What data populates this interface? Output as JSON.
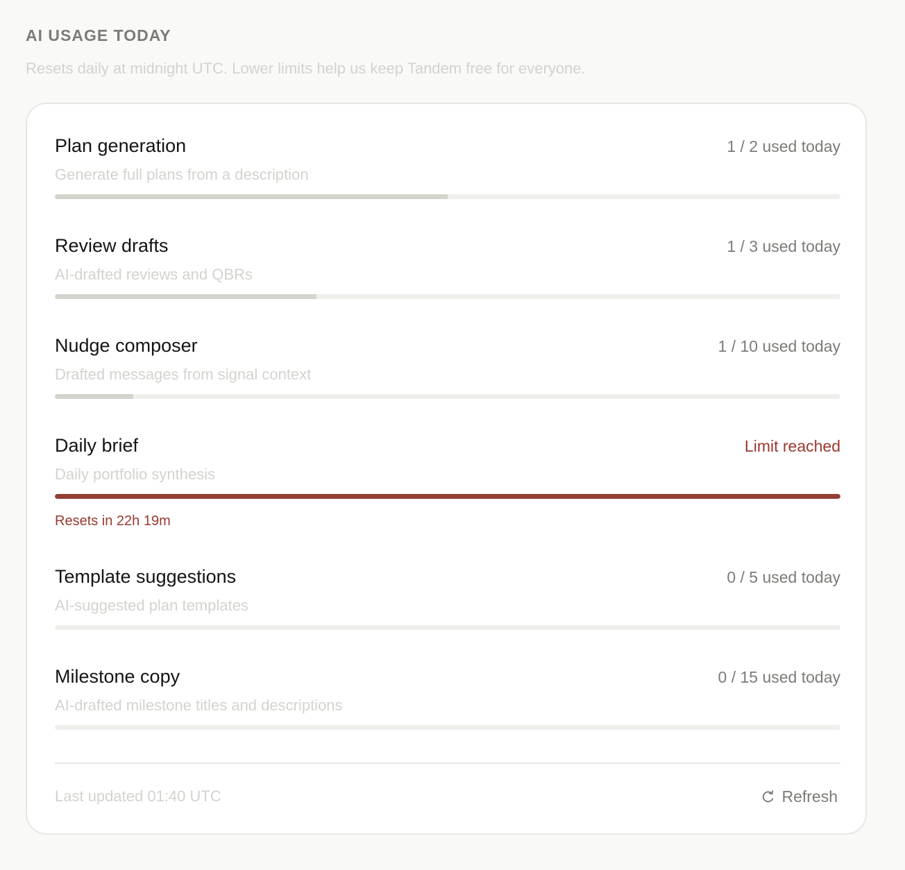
{
  "header": {
    "title": "AI USAGE TODAY",
    "subtitle": "Resets daily at midnight UTC. Lower limits help us keep Tandem free for everyone."
  },
  "usage_items": [
    {
      "name": "Plan generation",
      "description": "Generate full plans from a description",
      "used": 1,
      "limit": 2,
      "status_text": "1 / 2 used today",
      "fraction": 0.5
    },
    {
      "name": "Review drafts",
      "description": "AI-drafted reviews and QBRs",
      "used": 1,
      "limit": 3,
      "status_text": "1 / 3 used today",
      "fraction": 0.3333
    },
    {
      "name": "Nudge composer",
      "description": "Drafted messages from signal context",
      "used": 1,
      "limit": 10,
      "status_text": "1 / 10 used today",
      "fraction": 0.1
    },
    {
      "name": "Daily brief",
      "description": "Daily portfolio synthesis",
      "status_text": "Limit reached",
      "fraction": 1.0,
      "reset_text": "Resets in 22h 19m"
    },
    {
      "name": "Template suggestions",
      "description": "AI-suggested plan templates",
      "used": 0,
      "limit": 5,
      "status_text": "0 / 5 used today",
      "fraction": 0
    },
    {
      "name": "Milestone copy",
      "description": "AI-drafted milestone titles and descriptions",
      "used": 0,
      "limit": 15,
      "status_text": "0 / 15 used today",
      "fraction": 0
    }
  ],
  "footer": {
    "last_updated": "Last updated 01:40 UTC",
    "refresh_label": "Refresh",
    "refresh_icon": "refresh-icon"
  },
  "colors": {
    "background": "#f9f9f7",
    "card": "#ffffff",
    "bar_track": "#efefeb",
    "bar_fill": "#d4d4ce",
    "limit_accent": "#933f35"
  }
}
